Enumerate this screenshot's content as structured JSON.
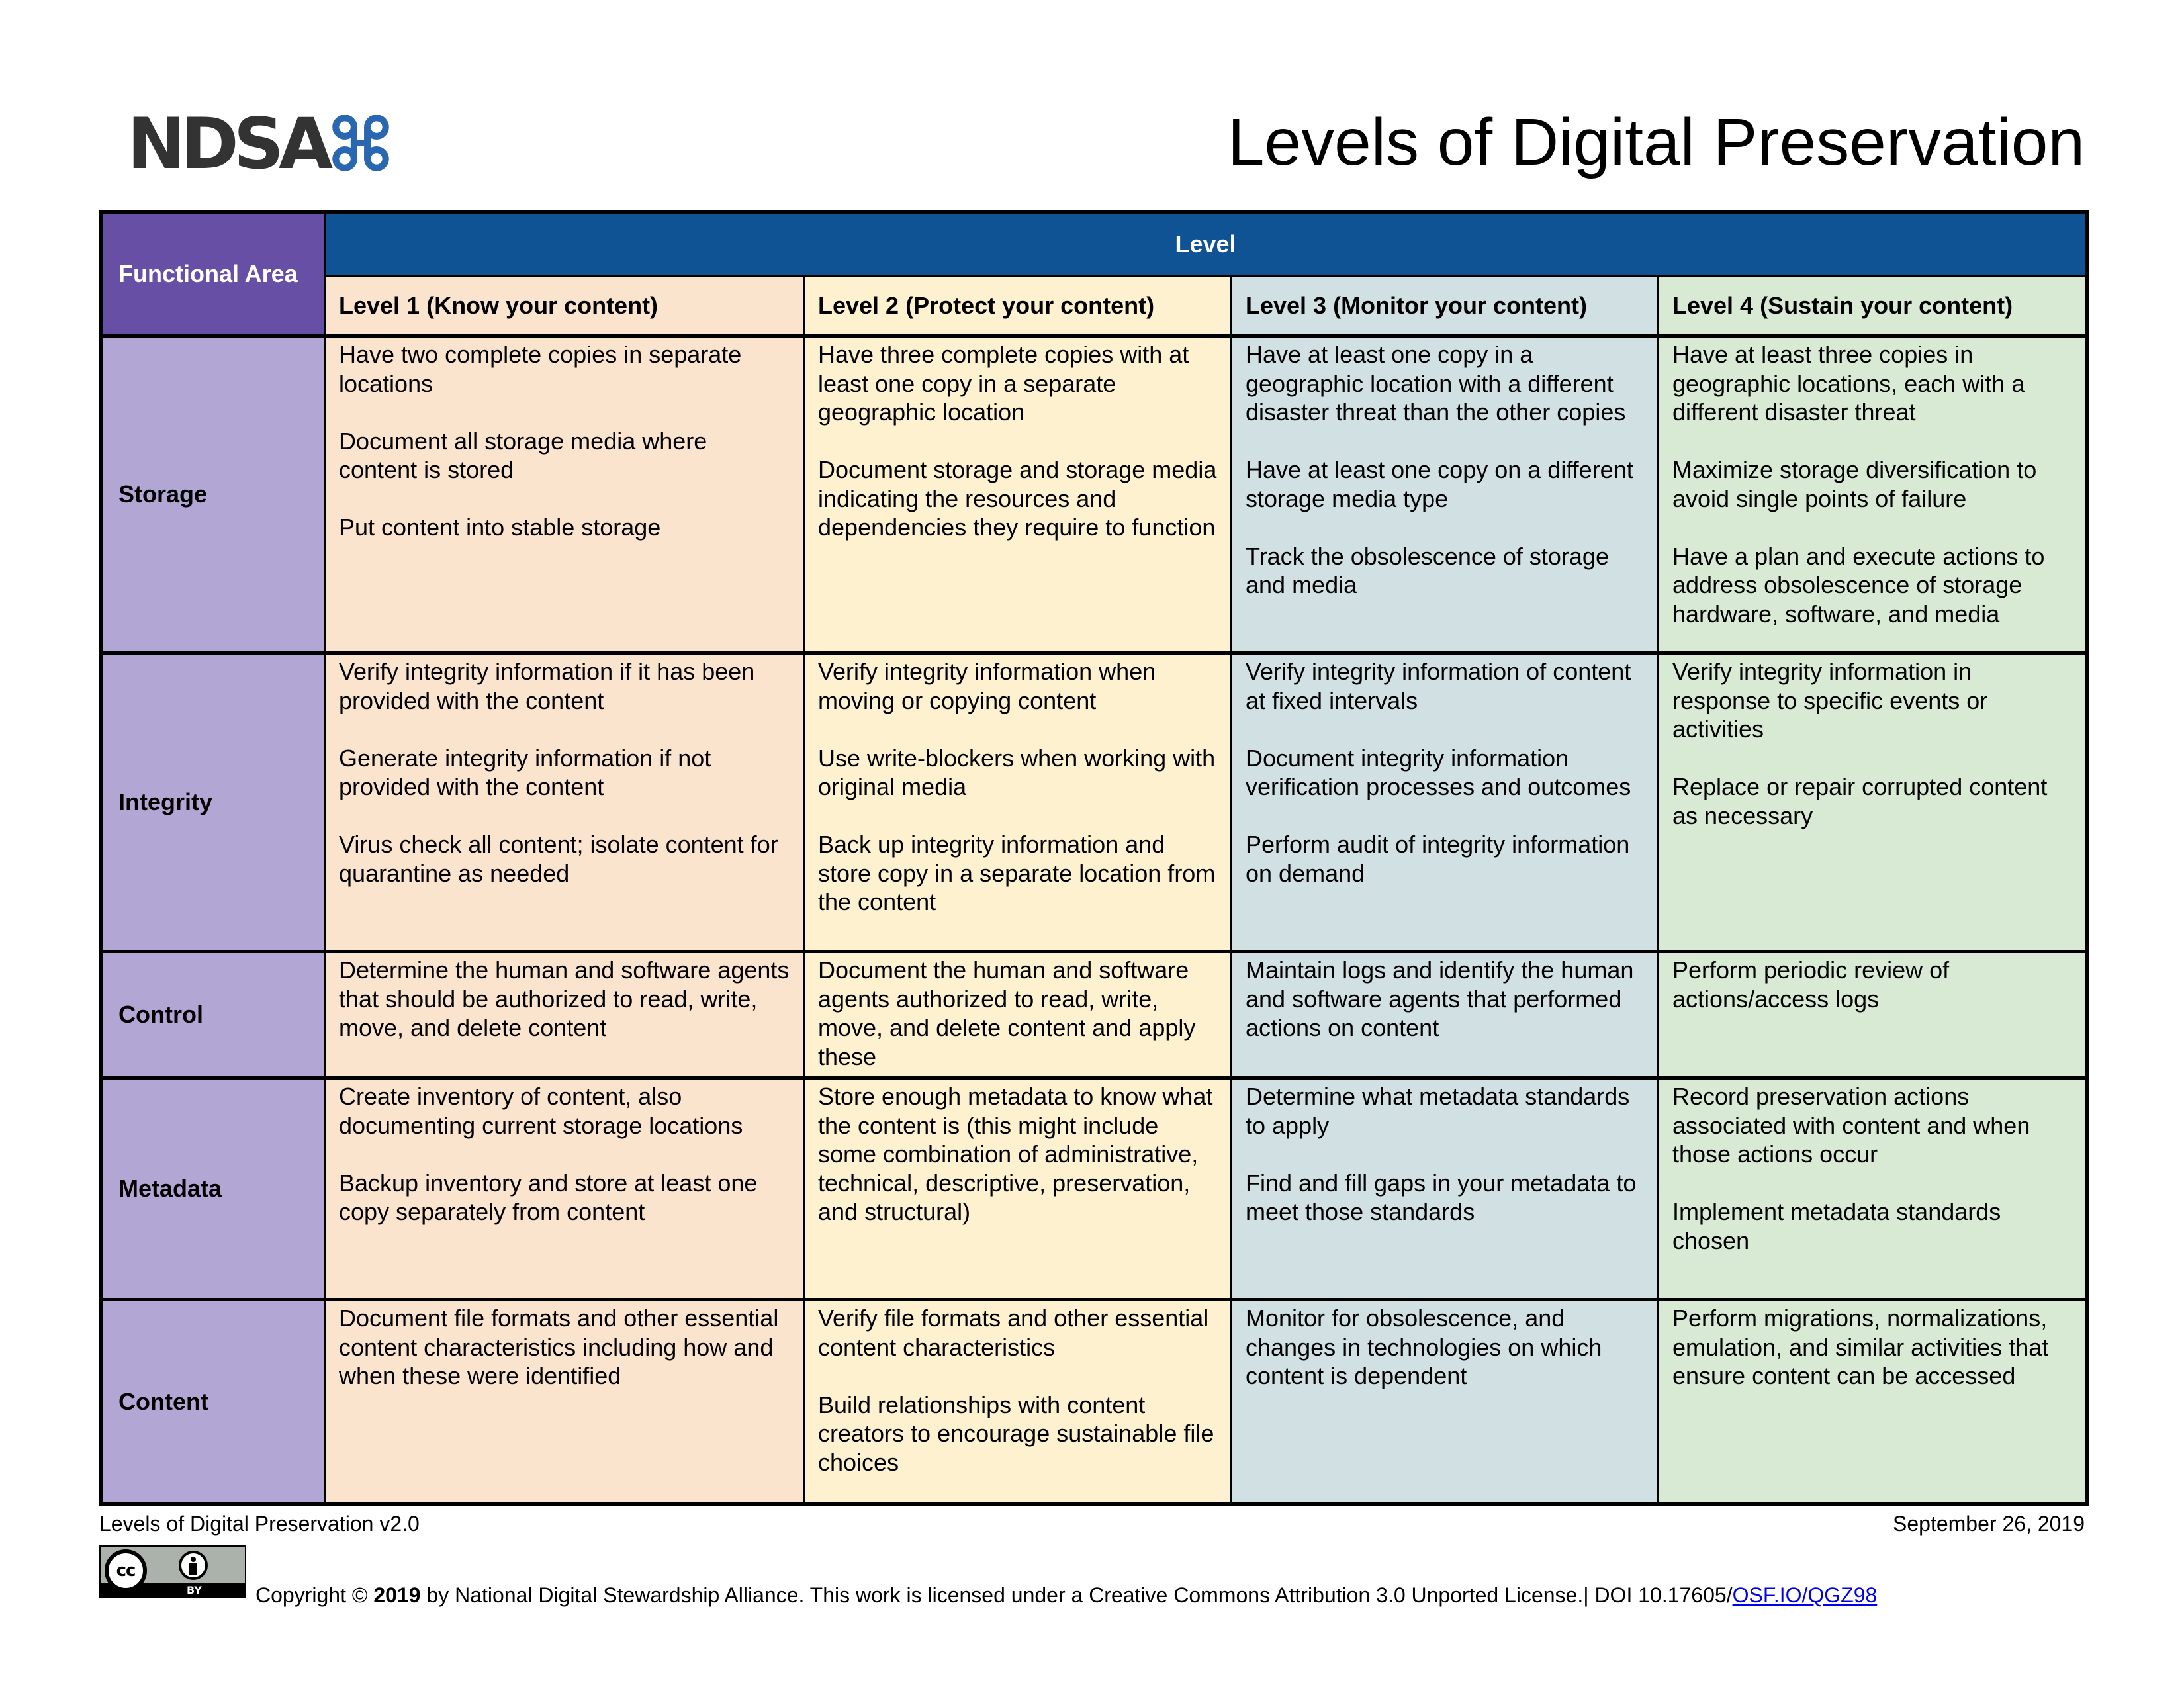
{
  "header": {
    "logo_text": "NDSA",
    "logo_mark_icon": "ndsa-knot-icon",
    "logo_color": "#2a67b1",
    "title": "Levels of Digital Preservation"
  },
  "table": {
    "functional_area_label": "Functional Area",
    "level_label": "Level",
    "level_headers": [
      "Level 1 (Know your content)",
      "Level 2 (Protect your content)",
      "Level 3 (Monitor your content)",
      "Level 4 (Sustain your content)"
    ],
    "colors": {
      "functional_area_header": "#674fa6",
      "functional_area_cells": "#b2a6d5",
      "level_bar": "#0f5395",
      "level1": "#fbe4cd",
      "level2": "#fef1cf",
      "level3": "#d0e0e3",
      "level4": "#d9ead4"
    },
    "rows": [
      {
        "area": "Storage",
        "levels": [
          [
            "Have two complete copies in separate locations",
            "Document all storage media where content is stored",
            "Put content into stable storage"
          ],
          [
            "Have three complete copies with at least one copy in a separate geographic location",
            "Document storage and storage media indicating the resources and dependencies they require to function"
          ],
          [
            "Have at least one copy in a geographic location with a different disaster threat than the other copies",
            "Have at least one copy on a different storage media type",
            "Track the obsolescence of storage and media"
          ],
          [
            "Have at least three copies in geographic locations, each with a different disaster threat",
            "Maximize storage diversification to avoid single points of failure",
            "Have a plan and execute actions to address obsolescence of storage hardware, software, and media"
          ]
        ]
      },
      {
        "area": "Integrity",
        "levels": [
          [
            "Verify integrity information if it has been provided with the content",
            "Generate integrity information if not provided with the content",
            "Virus check all content; isolate content for quarantine as needed"
          ],
          [
            "Verify integrity information when moving or copying content",
            "Use write-blockers when working with original media",
            "Back up integrity information and store copy in a separate location from the content"
          ],
          [
            "Verify integrity information of content at fixed intervals",
            "Document integrity information verification processes and outcomes",
            "Perform audit of integrity information on demand"
          ],
          [
            "Verify integrity information in response to specific events or activities",
            "Replace or repair corrupted content as necessary"
          ]
        ]
      },
      {
        "area": "Control",
        "levels": [
          [
            "Determine the human and software agents that should be authorized to read, write, move, and delete content"
          ],
          [
            "Document the human and software agents authorized to read, write, move, and delete content and apply these"
          ],
          [
            "Maintain logs and identify the human and software agents that performed actions on content"
          ],
          [
            "Perform periodic review of actions/access logs"
          ]
        ]
      },
      {
        "area": "Metadata",
        "levels": [
          [
            "Create inventory of content, also documenting current storage locations",
            "Backup inventory and store at least one copy separately from content"
          ],
          [
            "Store enough metadata to know what the content is (this might include some combination of administrative, technical, descriptive, preservation, and structural)"
          ],
          [
            "Determine what metadata standards to apply",
            "Find and fill gaps in your metadata to meet those standards"
          ],
          [
            "Record preservation actions associated with content and when those actions occur",
            "Implement metadata standards chosen"
          ]
        ]
      },
      {
        "area": "Content",
        "levels": [
          [
            "Document file formats and other essential content characteristics including how and when these were identified"
          ],
          [
            "Verify file formats and other essential content characteristics",
            "Build relationships with content creators to encourage sustainable file choices"
          ],
          [
            "Monitor for obsolescence, and changes in technologies on which content is dependent"
          ],
          [
            "Perform migrations, normalizations, emulation, and similar activities that ensure content can be accessed"
          ]
        ]
      }
    ]
  },
  "footer": {
    "version": "Levels of Digital Preservation v2.0",
    "date": "September 26, 2019",
    "license_icon": "creative-commons-by-icon",
    "license_badge_cc": "cc",
    "license_badge_by": "BY",
    "copyright_prefix": "Copyright © ",
    "copyright_year": "2019",
    "copyright_suffix": " by National Digital Stewardship Alliance. This work is licensed under a Creative Commons Attribution 3.0 Unported License.| DOI 10.17605/",
    "doi_link": "OSF.IO/QGZ98"
  }
}
